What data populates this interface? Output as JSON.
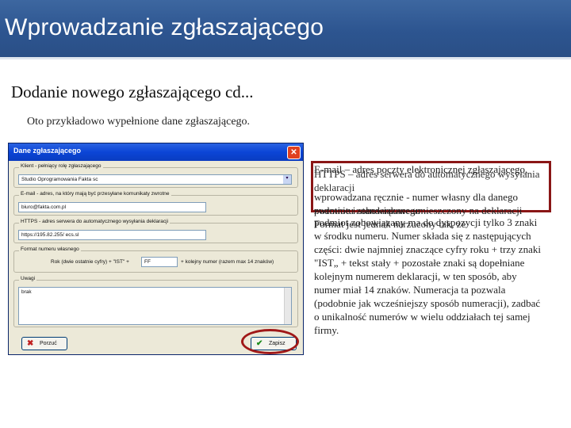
{
  "header": {
    "title": "Wprowadzanie zgłaszającego"
  },
  "content": {
    "subtitle": "Dodanie nowego zgłaszającego cd...",
    "intro": "Oto przykładowo wypełnione dane zgłaszającego."
  },
  "dialog": {
    "title": "Dane zgłaszającego",
    "close_glyph": "✕",
    "groups": {
      "client": {
        "label": "Klient - pełniący rolę zgłaszającego",
        "value": "Studio Oprogramowania Fakta sc",
        "search_glyph": "▾"
      },
      "email": {
        "label": "E-mail - adres, na który mają być przesyłane komunikaty zwrotne",
        "value": "biuro@fakta.com.pl"
      },
      "https": {
        "label": "HTTPS - adres serwera do automatycznego wysyłania deklaracji",
        "value": "https://195.82.255/ ecs.sl"
      },
      "number_format": {
        "label": "Format numeru własnego",
        "prefix_label": "Rok (dwie ostatnie cyfry) + \"IST\" +",
        "value": "FF",
        "suffix_label": "+ kolejny numer (razem max 14 znaków)"
      },
      "notes": {
        "label": "Uwagi",
        "value": "brak"
      }
    },
    "buttons": {
      "cancel": {
        "label": "Porzuć",
        "icon": "✖"
      },
      "save": {
        "label": "Zapisz",
        "icon": "✔"
      }
    }
  },
  "callout": {
    "layer_a": "E-mail – adres poczty elektronicznej zgłaszającego,",
    "layer_b": "HTTPS – adres serwera do automatycznego wysyłania deklaracji",
    "layer_c": "wprowadzana ręcznie - numer własny dla danego podmiotu zobowiązanego",
    "layer_d": "zwrotnie i standardowe umieszczony na deklaracji Format jest jednak narzucony tak, że"
  },
  "description": "podmiot zobowiązany ma do dyspozycji tylko 3 znaki w środku numeru. Numer składa się z następujących części: dwie najmniej znaczące cyfry roku + trzy znaki \"IST„ + tekst stały + pozostałe znaki są dopełniane kolejnym numerem deklaracji, w ten sposób, aby numer miał 14 znaków. Numeracja ta pozwala (podobnie jak wcześniejszy sposób numeracji), zadbać o unikalność numerów w wielu oddziałach tej samej firmy."
}
